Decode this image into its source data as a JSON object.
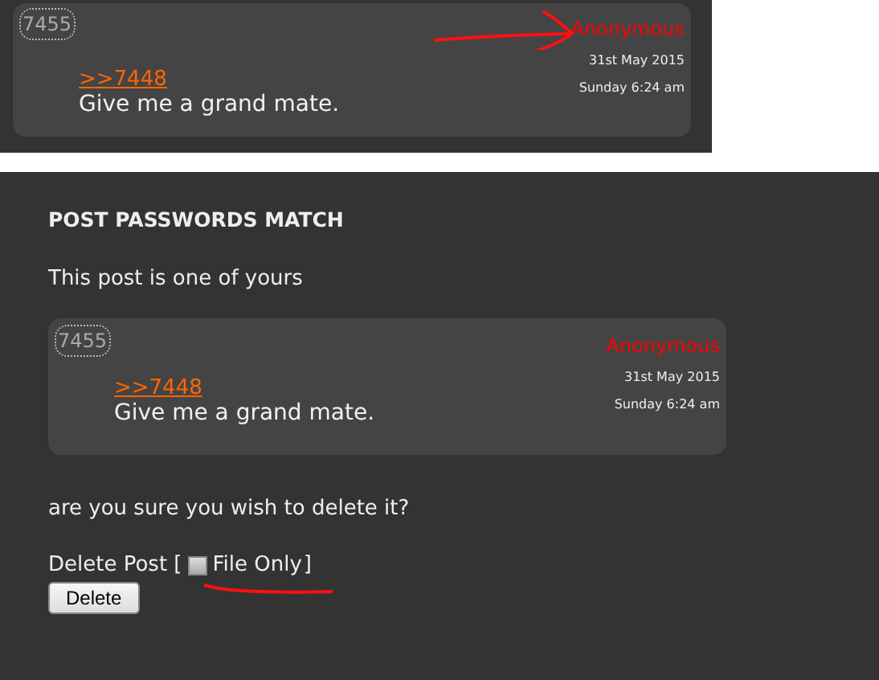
{
  "excerpt": {
    "post": {
      "number": "7455",
      "author": "Anonymous",
      "date": "31st May 2015",
      "time": "Sunday 6:24 am",
      "reply_link": ">>7448",
      "message": "Give me a grand mate."
    }
  },
  "dialog": {
    "title": "POST PASSWORDS MATCH",
    "note": "This post is one of yours",
    "post": {
      "number": "7455",
      "author": "Anonymous",
      "date": "31st May 2015",
      "time": "Sunday 6:24 am",
      "reply_link": ">>7448",
      "message": "Give me a grand mate."
    },
    "question": "are you sure you wish to delete it?",
    "delete_prefix": "Delete Post [",
    "file_only": {
      "label": "File Only",
      "checked": false
    },
    "delete_suffix": "]",
    "button": "Delete"
  }
}
